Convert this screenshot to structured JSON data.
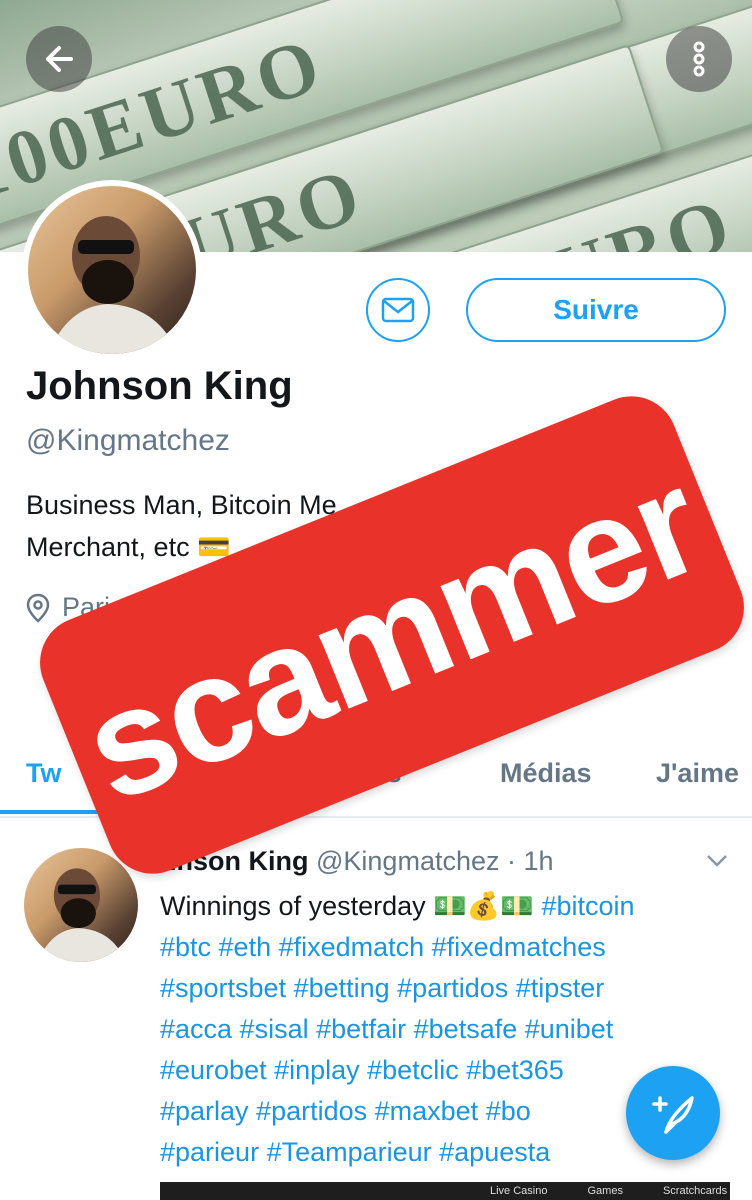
{
  "banner": {
    "note_text": "100EURO",
    "back_icon": "arrow-left-icon",
    "menu_icon": "more-vertical-icon"
  },
  "profile": {
    "name": "Johnson King",
    "handle": "@Kingmatchez",
    "bio_line1": "Business Man, Bitcoin Me",
    "bio_line2": "Merchant, etc 💳",
    "location": "Paris, F",
    "follow_label": "Suivre",
    "message_icon": "envelope-icon"
  },
  "tabs": [
    {
      "label": "Tw"
    },
    {
      "label": "nses"
    },
    {
      "label": "Médias"
    },
    {
      "label": "J'aime"
    }
  ],
  "tweet": {
    "name": "hnson King",
    "handle": "@Kingmatchez",
    "time": "· 1h",
    "text_start": "Winnings of yesterday 💵💰💵 ",
    "hashtags_line1": "#bitcoin",
    "line2": "#btc #eth #fixedmatch #fixedmatches",
    "line3": "#sportsbet #betting #partidos  #tipster",
    "line4": "#acca #sisal #betfair #betsafe #unibet",
    "line5": "#eurobet #inplay #betclic #bet365",
    "line6": "#parlay #partidos #maxbet #bo",
    "line7": "#parieur #Teamparieur #apuesta"
  },
  "media_strip": [
    "Live Casino",
    "Games",
    "Scratchcards"
  ],
  "stamp": {
    "text": "scammer"
  },
  "colors": {
    "accent": "#1da1f2",
    "stamp": "#e8322a",
    "muted": "#657786"
  }
}
